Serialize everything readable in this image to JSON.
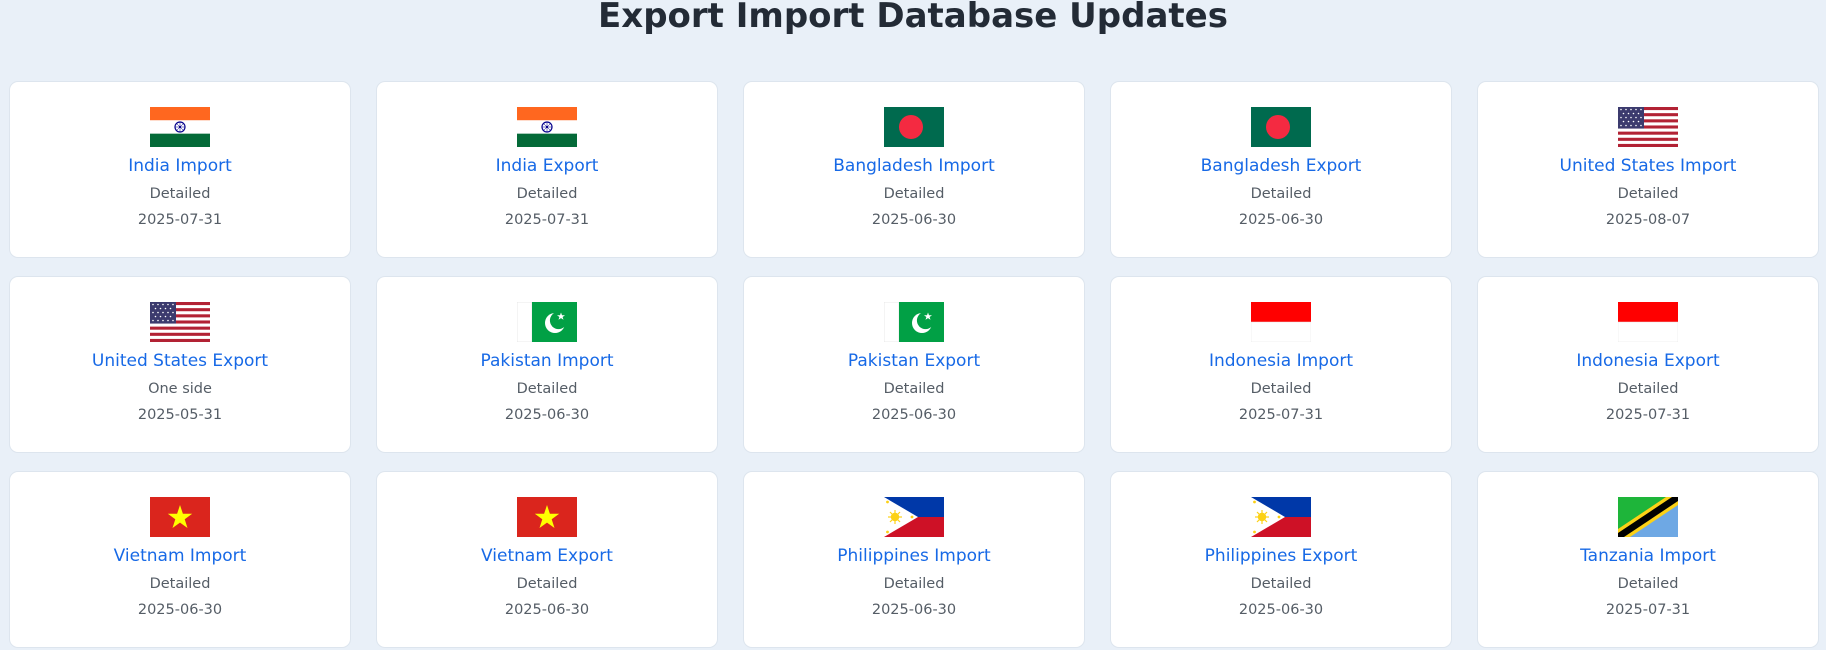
{
  "page": {
    "title": "Export Import Database Updates"
  },
  "cards": [
    {
      "title": "India Import",
      "type": "Detailed",
      "date": "2025-07-31",
      "flag": "india-flag-icon"
    },
    {
      "title": "India Export",
      "type": "Detailed",
      "date": "2025-07-31",
      "flag": "india-flag-icon"
    },
    {
      "title": "Bangladesh Import",
      "type": "Detailed",
      "date": "2025-06-30",
      "flag": "bangladesh-flag-icon"
    },
    {
      "title": "Bangladesh Export",
      "type": "Detailed",
      "date": "2025-06-30",
      "flag": "bangladesh-flag-icon"
    },
    {
      "title": "United States Import",
      "type": "Detailed",
      "date": "2025-08-07",
      "flag": "usa-flag-icon"
    },
    {
      "title": "United States Export",
      "type": "One side",
      "date": "2025-05-31",
      "flag": "usa-flag-icon"
    },
    {
      "title": "Pakistan Import",
      "type": "Detailed",
      "date": "2025-06-30",
      "flag": "pakistan-flag-icon"
    },
    {
      "title": "Pakistan Export",
      "type": "Detailed",
      "date": "2025-06-30",
      "flag": "pakistan-flag-icon"
    },
    {
      "title": "Indonesia Import",
      "type": "Detailed",
      "date": "2025-07-31",
      "flag": "indonesia-flag-icon"
    },
    {
      "title": "Indonesia Export",
      "type": "Detailed",
      "date": "2025-07-31",
      "flag": "indonesia-flag-icon"
    },
    {
      "title": "Vietnam Import",
      "type": "Detailed",
      "date": "2025-06-30",
      "flag": "vietnam-flag-icon"
    },
    {
      "title": "Vietnam Export",
      "type": "Detailed",
      "date": "2025-06-30",
      "flag": "vietnam-flag-icon"
    },
    {
      "title": "Philippines Import",
      "type": "Detailed",
      "date": "2025-06-30",
      "flag": "philippines-flag-icon"
    },
    {
      "title": "Philippines Export",
      "type": "Detailed",
      "date": "2025-06-30",
      "flag": "philippines-flag-icon"
    },
    {
      "title": "Tanzania Import",
      "type": "Detailed",
      "date": "2025-07-31",
      "flag": "tanzania-flag-icon"
    }
  ],
  "colors": {
    "background": "#e9f0f8",
    "card": "#ffffff",
    "link": "#1769e6",
    "title": "#232b36",
    "meta": "#555d66"
  }
}
